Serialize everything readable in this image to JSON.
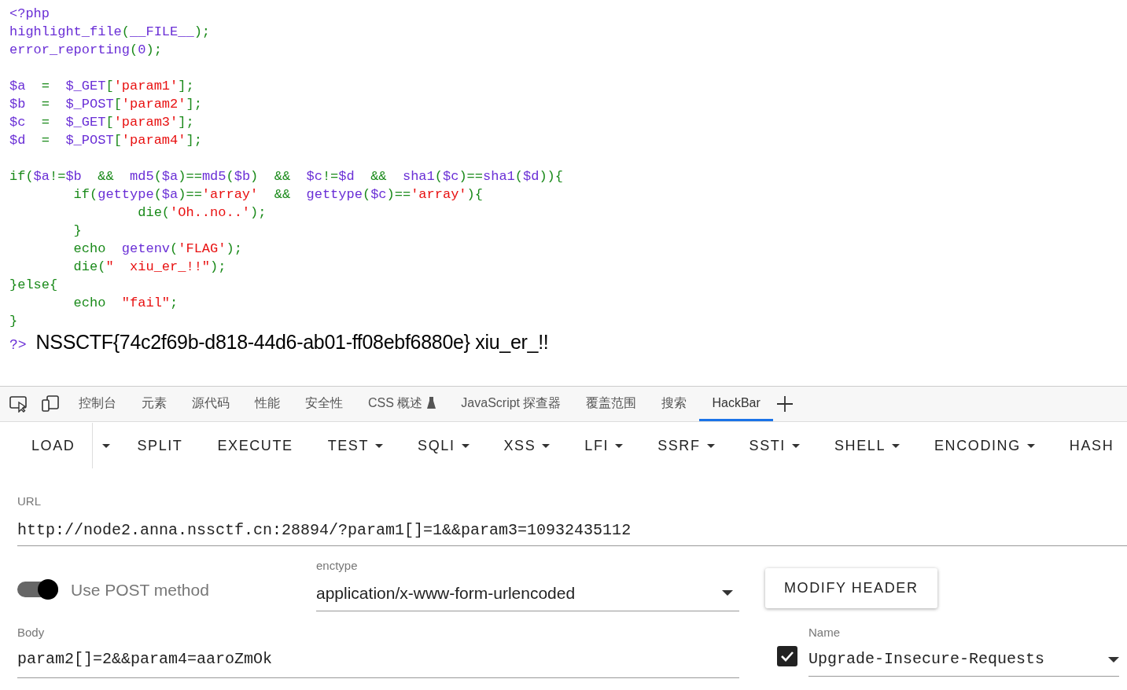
{
  "code": {
    "lines": [
      {
        "kind": "code",
        "segments": [
          {
            "text": "<?php",
            "kind": "default"
          }
        ]
      },
      {
        "kind": "code",
        "segments": [
          {
            "text": "highlight_file",
            "kind": "default"
          },
          {
            "text": "(",
            "kind": "keyword"
          },
          {
            "text": "__FILE__",
            "kind": "default"
          },
          {
            "text": ");",
            "kind": "keyword"
          }
        ]
      },
      {
        "kind": "code",
        "segments": [
          {
            "text": "error_reporting",
            "kind": "default"
          },
          {
            "text": "(",
            "kind": "keyword"
          },
          {
            "text": "0",
            "kind": "default"
          },
          {
            "text": ");",
            "kind": "keyword"
          }
        ]
      },
      {
        "kind": "blank"
      },
      {
        "kind": "code",
        "segments": [
          {
            "text": "$a",
            "kind": "default"
          },
          {
            "text": "  =  ",
            "kind": "keyword"
          },
          {
            "text": "$_GET",
            "kind": "default"
          },
          {
            "text": "[",
            "kind": "keyword"
          },
          {
            "text": "'param1'",
            "kind": "string"
          },
          {
            "text": "];",
            "kind": "keyword"
          }
        ]
      },
      {
        "kind": "code",
        "segments": [
          {
            "text": "$b",
            "kind": "default"
          },
          {
            "text": "  =  ",
            "kind": "keyword"
          },
          {
            "text": "$_POST",
            "kind": "default"
          },
          {
            "text": "[",
            "kind": "keyword"
          },
          {
            "text": "'param2'",
            "kind": "string"
          },
          {
            "text": "];",
            "kind": "keyword"
          }
        ]
      },
      {
        "kind": "code",
        "segments": [
          {
            "text": "$c",
            "kind": "default"
          },
          {
            "text": "  =  ",
            "kind": "keyword"
          },
          {
            "text": "$_GET",
            "kind": "default"
          },
          {
            "text": "[",
            "kind": "keyword"
          },
          {
            "text": "'param3'",
            "kind": "string"
          },
          {
            "text": "];",
            "kind": "keyword"
          }
        ]
      },
      {
        "kind": "code",
        "segments": [
          {
            "text": "$d",
            "kind": "default"
          },
          {
            "text": "  =  ",
            "kind": "keyword"
          },
          {
            "text": "$_POST",
            "kind": "default"
          },
          {
            "text": "[",
            "kind": "keyword"
          },
          {
            "text": "'param4'",
            "kind": "string"
          },
          {
            "text": "];",
            "kind": "keyword"
          }
        ]
      },
      {
        "kind": "blank"
      },
      {
        "kind": "code",
        "segments": [
          {
            "text": "if(",
            "kind": "keyword"
          },
          {
            "text": "$a",
            "kind": "default"
          },
          {
            "text": "!=",
            "kind": "keyword"
          },
          {
            "text": "$b",
            "kind": "default"
          },
          {
            "text": "  &&  ",
            "kind": "keyword"
          },
          {
            "text": "md5",
            "kind": "default"
          },
          {
            "text": "(",
            "kind": "keyword"
          },
          {
            "text": "$a",
            "kind": "default"
          },
          {
            "text": ")==",
            "kind": "keyword"
          },
          {
            "text": "md5",
            "kind": "default"
          },
          {
            "text": "(",
            "kind": "keyword"
          },
          {
            "text": "$b",
            "kind": "default"
          },
          {
            "text": ")  &&  ",
            "kind": "keyword"
          },
          {
            "text": "$c",
            "kind": "default"
          },
          {
            "text": "!=",
            "kind": "keyword"
          },
          {
            "text": "$d",
            "kind": "default"
          },
          {
            "text": "  &&  ",
            "kind": "keyword"
          },
          {
            "text": "sha1",
            "kind": "default"
          },
          {
            "text": "(",
            "kind": "keyword"
          },
          {
            "text": "$c",
            "kind": "default"
          },
          {
            "text": ")==",
            "kind": "keyword"
          },
          {
            "text": "sha1",
            "kind": "default"
          },
          {
            "text": "(",
            "kind": "keyword"
          },
          {
            "text": "$d",
            "kind": "default"
          },
          {
            "text": ")){",
            "kind": "keyword"
          }
        ]
      },
      {
        "kind": "code",
        "segments": [
          {
            "text": "        if(",
            "kind": "keyword"
          },
          {
            "text": "gettype",
            "kind": "default"
          },
          {
            "text": "(",
            "kind": "keyword"
          },
          {
            "text": "$a",
            "kind": "default"
          },
          {
            "text": ")==",
            "kind": "keyword"
          },
          {
            "text": "'array'",
            "kind": "string"
          },
          {
            "text": "  &&  ",
            "kind": "keyword"
          },
          {
            "text": "gettype",
            "kind": "default"
          },
          {
            "text": "(",
            "kind": "keyword"
          },
          {
            "text": "$c",
            "kind": "default"
          },
          {
            "text": ")==",
            "kind": "keyword"
          },
          {
            "text": "'array'",
            "kind": "string"
          },
          {
            "text": "){",
            "kind": "keyword"
          }
        ]
      },
      {
        "kind": "code",
        "segments": [
          {
            "text": "                die(",
            "kind": "keyword"
          },
          {
            "text": "'Oh..no..'",
            "kind": "string"
          },
          {
            "text": ");",
            "kind": "keyword"
          }
        ]
      },
      {
        "kind": "code",
        "segments": [
          {
            "text": "        }",
            "kind": "keyword"
          }
        ]
      },
      {
        "kind": "code",
        "segments": [
          {
            "text": "        echo  ",
            "kind": "keyword"
          },
          {
            "text": "getenv",
            "kind": "default"
          },
          {
            "text": "(",
            "kind": "keyword"
          },
          {
            "text": "'FLAG'",
            "kind": "string"
          },
          {
            "text": ");",
            "kind": "keyword"
          }
        ]
      },
      {
        "kind": "code",
        "segments": [
          {
            "text": "        die(",
            "kind": "keyword"
          },
          {
            "text": "\"  xiu_er_!!\"",
            "kind": "string"
          },
          {
            "text": ");",
            "kind": "keyword"
          }
        ]
      },
      {
        "kind": "code",
        "segments": [
          {
            "text": "}else{",
            "kind": "keyword"
          }
        ]
      },
      {
        "kind": "code",
        "segments": [
          {
            "text": "        echo  ",
            "kind": "keyword"
          },
          {
            "text": "\"fail\"",
            "kind": "string"
          },
          {
            "text": ";",
            "kind": "keyword"
          }
        ]
      },
      {
        "kind": "code",
        "segments": [
          {
            "text": "}",
            "kind": "keyword"
          }
        ]
      }
    ],
    "close_tag": "?>",
    "output": "NSSCTF{74c2f69b-d818-44d6-ab01-ff08ebf6880e} xiu_er_!!"
  },
  "devtools_tabs": [
    {
      "label": "控制台",
      "selected": false
    },
    {
      "label": "元素",
      "selected": false
    },
    {
      "label": "源代码",
      "selected": false
    },
    {
      "label": "性能",
      "selected": false
    },
    {
      "label": "安全性",
      "selected": false
    },
    {
      "label": "CSS 概述",
      "selected": false,
      "experimental": true
    },
    {
      "label": "JavaScript 探查器",
      "selected": false
    },
    {
      "label": "覆盖范围",
      "selected": false
    },
    {
      "label": "搜索",
      "selected": false
    },
    {
      "label": "HackBar",
      "selected": true
    }
  ],
  "toolbar": [
    {
      "label": "LOAD",
      "dropdown": false,
      "split": true
    },
    {
      "label": "SPLIT",
      "dropdown": false
    },
    {
      "label": "EXECUTE",
      "dropdown": false
    },
    {
      "label": "TEST",
      "dropdown": true
    },
    {
      "label": "SQLI",
      "dropdown": true
    },
    {
      "label": "XSS",
      "dropdown": true
    },
    {
      "label": "LFI",
      "dropdown": true
    },
    {
      "label": "SSRF",
      "dropdown": true
    },
    {
      "label": "SSTI",
      "dropdown": true
    },
    {
      "label": "SHELL",
      "dropdown": true
    },
    {
      "label": "ENCODING",
      "dropdown": true
    },
    {
      "label": "HASH",
      "dropdown": false
    }
  ],
  "url": {
    "label": "URL",
    "value": "http://node2.anna.nssctf.cn:28894/?param1[]=1&&param3=10932435112"
  },
  "post_toggle": {
    "label": "Use POST method",
    "on": true
  },
  "enctype": {
    "label": "enctype",
    "value": "application/x-www-form-urlencoded"
  },
  "modify_header_button": "MODIFY HEADER",
  "body": {
    "label": "Body",
    "value": "param2[]=2&&param4=aaroZmOk"
  },
  "header": {
    "checked": true,
    "label": "Name",
    "value": "Upgrade-Insecure-Requests"
  }
}
